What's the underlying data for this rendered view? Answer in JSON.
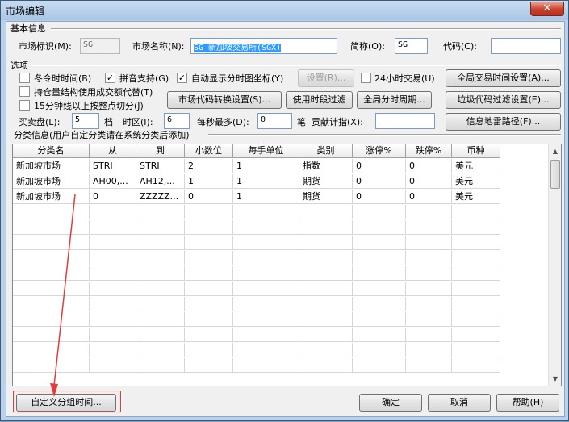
{
  "window": {
    "title": "市场编辑",
    "close_icon": "close-icon"
  },
  "basic": {
    "section_label": "基本信息",
    "market_id_label": "市场标识(M):",
    "market_id_value": "SG",
    "market_name_label": "市场名称(N):",
    "market_name_value": "SG 新加坡交易所(SGX)",
    "short_name_label": "简称(O):",
    "short_name_value": "SG",
    "code_label": "代码(C):",
    "code_value": ""
  },
  "options": {
    "section_label": "选项",
    "winter_time_label": "冬令时时间(B)",
    "winter_time_checked": false,
    "pinyin_label": "拼音支持(G)",
    "pinyin_checked": true,
    "auto_display_label": "自动显示分时图坐标(Y)",
    "auto_display_checked": true,
    "settings_button": "设置(R)...",
    "h24_label": "24小时交易(U)",
    "h24_checked": false,
    "global_trade_time_button": "全局交易时间设置(A)...",
    "open_interest_label": "持仓量结构使用成交额代替(T)",
    "open_interest_checked": false,
    "min15_label": "15分钟线以上按整点切分(J)",
    "min15_checked": false,
    "code_convert_button": "市场代码转换设置(S)...",
    "time_filter_button": "使用时段过滤",
    "global_period_button": "全局分时周期...",
    "junk_filter_button": "垃圾代码过滤设置(E)...",
    "bid_ask_label": "买卖盘(L):",
    "bid_ask_value": "5",
    "bid_ask_unit": "档",
    "timezone_label": "时区(I):",
    "timezone_value": "6",
    "per_second_label": "每秒最多(D):",
    "per_second_value": "0",
    "per_second_unit": "笔",
    "contribution_label": "贡献计指(X):",
    "contribution_value": "",
    "info_mine_button": "信息地雷路径(F)..."
  },
  "category": {
    "section_label": "分类信息(用户自定分类请在系统分类后添加)",
    "columns": [
      "分类名",
      "从",
      "到",
      "小数位",
      "每手单位",
      "类别",
      "涨停%",
      "跌停%",
      "币种"
    ],
    "rows": [
      [
        "新加坡市场",
        "STRI",
        "STRI",
        "2",
        "1",
        "指数",
        "0",
        "0",
        "美元"
      ],
      [
        "新加坡市场",
        "AH00,...",
        "AH12,...",
        "1",
        "1",
        "期货",
        "0",
        "0",
        "美元"
      ],
      [
        "新加坡市场",
        "0",
        "ZZZZZ...",
        "0",
        "1",
        "期货",
        "0",
        "0",
        "美元"
      ]
    ],
    "empty_rows": 11,
    "scroll_up_icon": "scroll-up-arrow-icon",
    "scroll_down_icon": "scroll-down-arrow-icon"
  },
  "footer": {
    "custom_group_button": "自定义分组时间...",
    "ok_button": "确定",
    "cancel_button": "取消",
    "help_button": "帮助(H)"
  },
  "annotation": {
    "highlight_color": "#e23b3b",
    "arrow_icon": "red-arrow-icon"
  }
}
